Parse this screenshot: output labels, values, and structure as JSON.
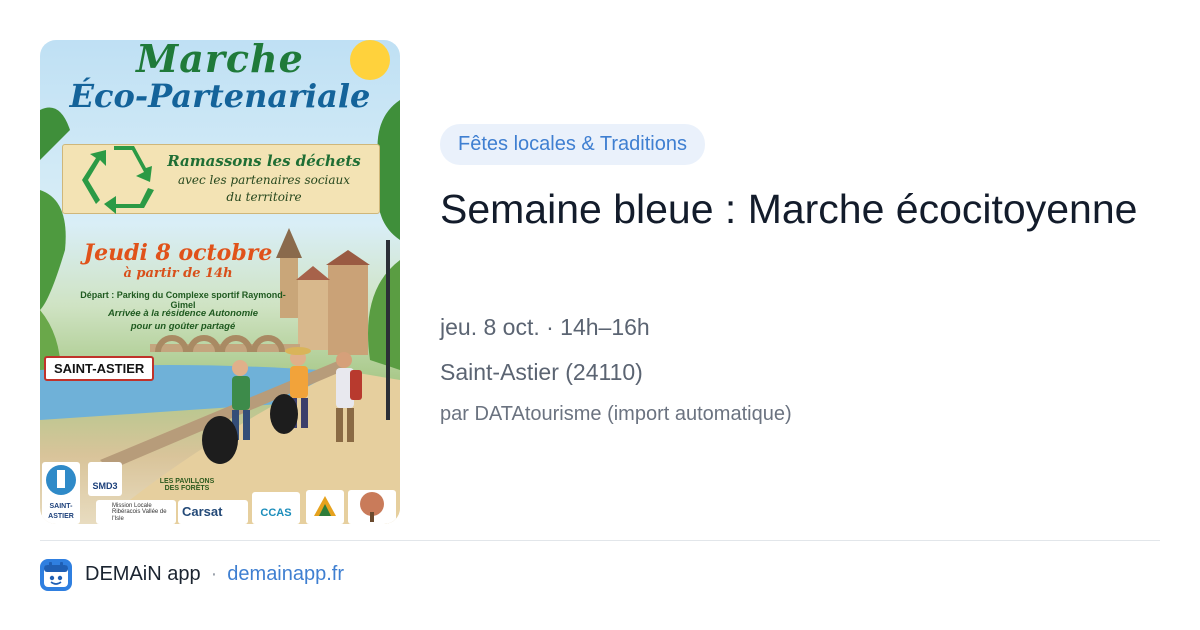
{
  "poster": {
    "title_line1": "Marche",
    "title_line2": "Éco-Partenariale",
    "banner_line1": "Ramassons les déchets",
    "banner_line2": "avec les partenaires sociaux",
    "banner_line3": "du territoire",
    "date": "Jeudi 8 octobre",
    "time": "à partir de 14h",
    "depart": "Départ : Parking du Complexe sportif Raymond-Gimel",
    "arrivee_line1": "Arrivée à la résidence Autonomie",
    "arrivee_line2": "pour un goûter partagé",
    "town_sign": "SAINT-ASTIER",
    "logos": {
      "ville": "VILLE DE SAINT-ASTIER",
      "smd3": "SMD3",
      "pavillons": "LES PAVILLONS DES FORÊTS",
      "mission": "Mission Locale Ribéracois Vallée de l'Isle",
      "carsat": "Carsat",
      "ccas": "CCAS"
    }
  },
  "event": {
    "category": "Fêtes locales & Traditions",
    "title": "Semaine bleue : Marche écocitoyenne",
    "datetime": "jeu. 8 oct. · 14h–16h",
    "location": "Saint-Astier (24110)",
    "source": "par DATAtourisme (import automatique)"
  },
  "footer": {
    "app_name": "DEMAiN app",
    "separator": "·",
    "domain": "demainapp.fr",
    "icon": "demain-app-icon"
  },
  "colors": {
    "accent": "#3f7fd1",
    "chip_bg": "#eaf1fb",
    "title": "#131c2b",
    "meta": "#5b6472"
  }
}
